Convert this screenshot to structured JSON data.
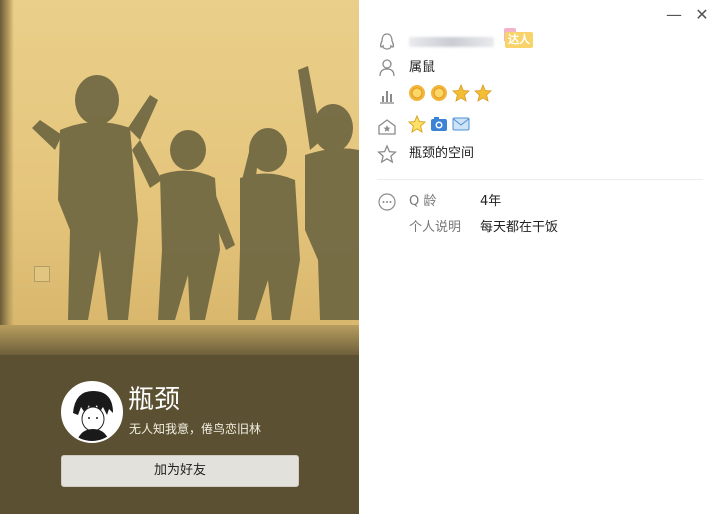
{
  "profile": {
    "nickname": "瓶颈",
    "signature": "无人知我意，倦鸟恋旧林",
    "add_friend_label": "加为好友",
    "vip_label": "达人",
    "zodiac": "属鼠",
    "space_label": "瓶颈的空间",
    "q_age_label": "Q 龄",
    "q_age_value": "4年",
    "bio_label": "个人说明",
    "bio_value": "每天都在干饭"
  },
  "window": {
    "minimize_glyph": "—",
    "close_glyph": "✕"
  },
  "icons": {
    "qq_account": "qq-penguin-icon",
    "zodiac": "person-icon",
    "level": "bar-chart-icon",
    "services": "house-star-icon",
    "space": "star-outline-icon",
    "more": "more-dots-icon"
  },
  "level_badges": [
    "sun",
    "sun",
    "star",
    "star"
  ],
  "colors": {
    "accent_gold": "#f2b53a",
    "left_panel_bg": "#5b5032",
    "photo_bg": "#e5c57c"
  }
}
